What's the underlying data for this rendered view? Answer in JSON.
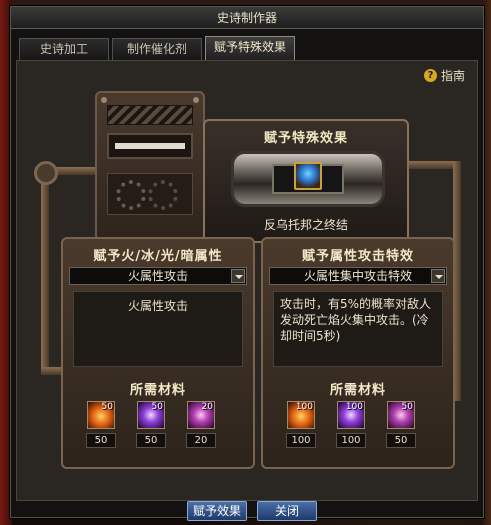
{
  "window": {
    "title": "史诗制作器"
  },
  "tabs": [
    {
      "label": "史诗加工",
      "active": false
    },
    {
      "label": "制作催化剂",
      "active": false
    },
    {
      "label": "赋予特殊效果",
      "active": true
    }
  ],
  "guide": {
    "icon": "question-icon",
    "label": "指南"
  },
  "effect": {
    "title": "赋予特殊效果",
    "item_icon": "epic-item-icon",
    "item_name": "反乌托邦之终结"
  },
  "left_panel": {
    "title": "赋予火/冰/光/暗属性",
    "dropdown_value": "火属性攻击",
    "description": "火属性攻击",
    "materials_title": "所需材料",
    "materials": [
      {
        "icon": "fire-crystal-icon",
        "have": "50",
        "need": "50"
      },
      {
        "icon": "purple-orb-icon",
        "have": "50",
        "need": "50"
      },
      {
        "icon": "violet-shard-icon",
        "have": "20",
        "need": "20"
      }
    ]
  },
  "right_panel": {
    "title": "赋予属性攻击特效",
    "dropdown_value": "火属性集中攻击特效",
    "description": "攻击时，有5%的概率对敌人发动死亡焰火集中攻击。(冷却时间5秒)",
    "materials_title": "所需材料",
    "materials": [
      {
        "icon": "fire-crystal-icon",
        "have": "100",
        "need": "100"
      },
      {
        "icon": "purple-orb-icon",
        "have": "100",
        "need": "100"
      },
      {
        "icon": "violet-shard-icon",
        "have": "50",
        "need": "50"
      }
    ]
  },
  "buttons": {
    "apply": "赋予效果",
    "close": "关闭"
  }
}
